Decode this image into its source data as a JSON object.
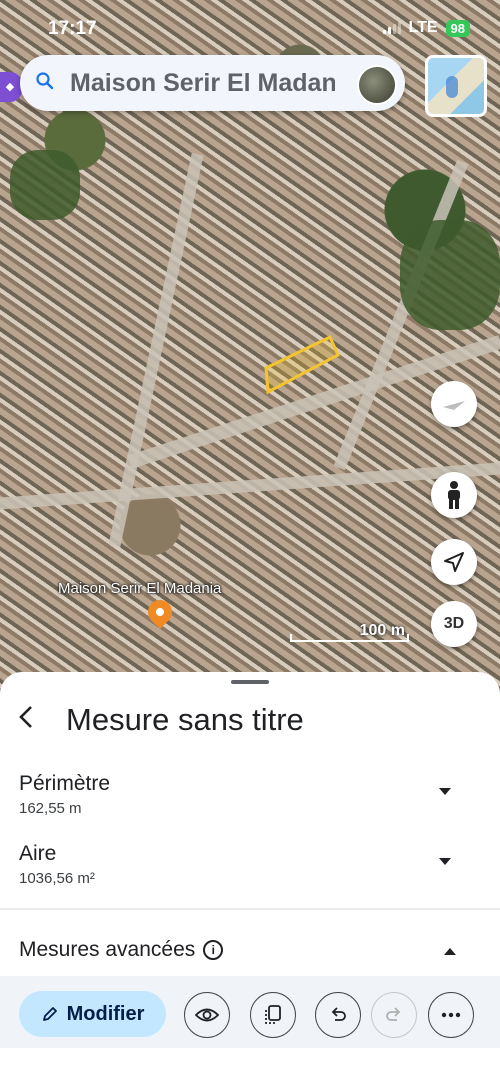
{
  "status_bar": {
    "time": "17:17",
    "network": "LTE",
    "battery": "98"
  },
  "search": {
    "text": "Maison Serir El Madania"
  },
  "map": {
    "place_label": "Maison Serir El Madania",
    "scale_label": "100 m",
    "controls": {
      "view_3d": "3D",
      "compass_icon": "compass-icon",
      "pegman_icon": "pegman-icon",
      "location_icon": "navigation-arrow-icon"
    },
    "measure_polygon_color": "#f4c430"
  },
  "sheet": {
    "title": "Mesure sans titre",
    "perimeter": {
      "label": "Périmètre",
      "value": "162,55 m"
    },
    "area": {
      "label": "Aire",
      "value": "1036,56 m²"
    },
    "advanced": {
      "label": "Mesures avancées",
      "info_glyph": "i"
    },
    "toolbar": {
      "modify_label": "Modifier"
    }
  }
}
